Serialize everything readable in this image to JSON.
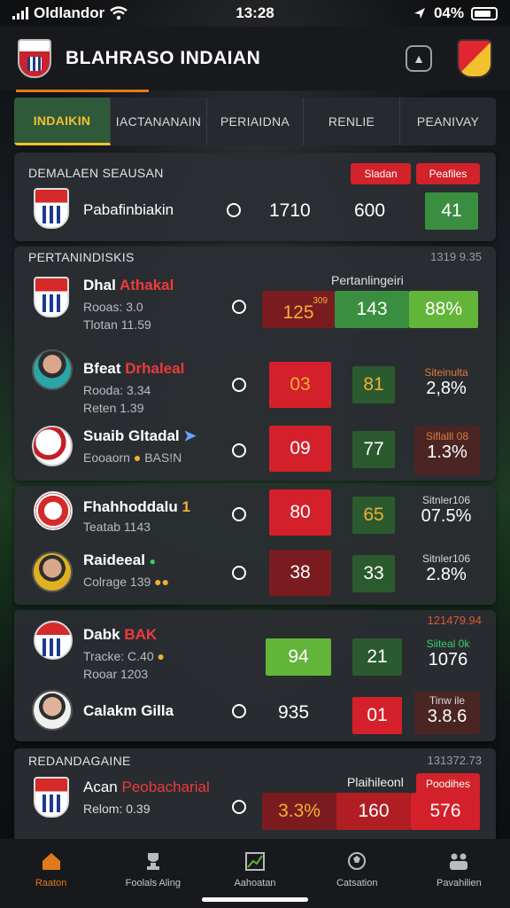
{
  "status_bar": {
    "carrier": "Oldlandor",
    "time": "13:28",
    "battery": "04%"
  },
  "header": {
    "title": "BLAHRASO INDAIAN"
  },
  "tabs": [
    {
      "label": "INDAIKIN",
      "active": true
    },
    {
      "label": "IACTANANAIN",
      "active": false
    },
    {
      "label": "PERIAIDNA",
      "active": false
    },
    {
      "label": "RENLIE",
      "active": false
    },
    {
      "label": "PEANIVAY",
      "active": false
    }
  ],
  "card1": {
    "title": "DEMALAEN SEAUSAN",
    "pill1": "Sladan",
    "pill2": "Peafiles",
    "team": "Pabafinbiakin",
    "val1": "1710",
    "val2": "600",
    "score": "41"
  },
  "card2": {
    "title": "PERTANINDISKIS",
    "meta": "1319 9.35",
    "column_label": "Pertanlingeiri",
    "row1": {
      "name_main": "Dhal",
      "name_accent": "Athakal",
      "sub1": "Rooas: 3.0",
      "sub2": "Tlotan 11.59",
      "s1_top": "309",
      "s1": "125",
      "s2": "143",
      "s3": "88%"
    },
    "row2": {
      "name_main": "Bfeat",
      "name_accent": "Drhaleal",
      "sub1": "Rooda: 3.34",
      "sub2": "Reten 1.39",
      "s1": "03",
      "s2": "81",
      "plabel": "Siteinulta",
      "pval": "2,8%"
    },
    "row3": {
      "name_main": "Suaib",
      "name_accent": "Gltadal",
      "sub1": "Eooaorn",
      "sub2": "BAS!N",
      "s1": "09",
      "s2": "77",
      "plabel": "Siflalll 08",
      "pval": "1.3%"
    }
  },
  "card3": {
    "row1": {
      "name": "Fhahhoddalu",
      "accent": "1",
      "sub": "Teatab 1143",
      "s1": "80",
      "s2": "65",
      "plabel": "Sitnler106",
      "pval": "07.5%"
    },
    "row2": {
      "name": "Raideeal",
      "sub": "Colrage 139",
      "s1": "38",
      "s2": "33",
      "plabel": "Sitnler106",
      "pval": "2.8%"
    }
  },
  "card4": {
    "meta": "121479.94",
    "row1": {
      "name_main": "Dabk",
      "name_accent": "BAK",
      "sub1": "Tracke: C.40",
      "sub2": "Rooar 1203",
      "s1": "94",
      "s2": "21",
      "plabel": "Siiteal 0k",
      "pval": "1076"
    },
    "row2": {
      "name": "Calakm Gilla",
      "val": "935",
      "s1": "01",
      "plabel": "Tinw ile",
      "pval": "3.8.6"
    }
  },
  "card5": {
    "title": "REDANDAGAINE",
    "meta": "131372.73",
    "pill1": "Plaihileonl",
    "pill2": "Poodihes",
    "name_main": "Acan",
    "name_accent": "Peobacharial",
    "sub": "Relom: 0.39",
    "s1_top": "3.3%",
    "s2": "160",
    "s3": "576"
  },
  "bottom_nav": [
    {
      "label": "Raaton",
      "icon": "home-icon",
      "active": true
    },
    {
      "label": "Foolals Aling",
      "icon": "trophy-icon",
      "active": false
    },
    {
      "label": "Aahoatan",
      "icon": "stats-icon",
      "active": false
    },
    {
      "label": "Catsation",
      "icon": "ball-icon",
      "active": false
    },
    {
      "label": "Pavahilien",
      "icon": "team-icon",
      "active": false
    }
  ]
}
